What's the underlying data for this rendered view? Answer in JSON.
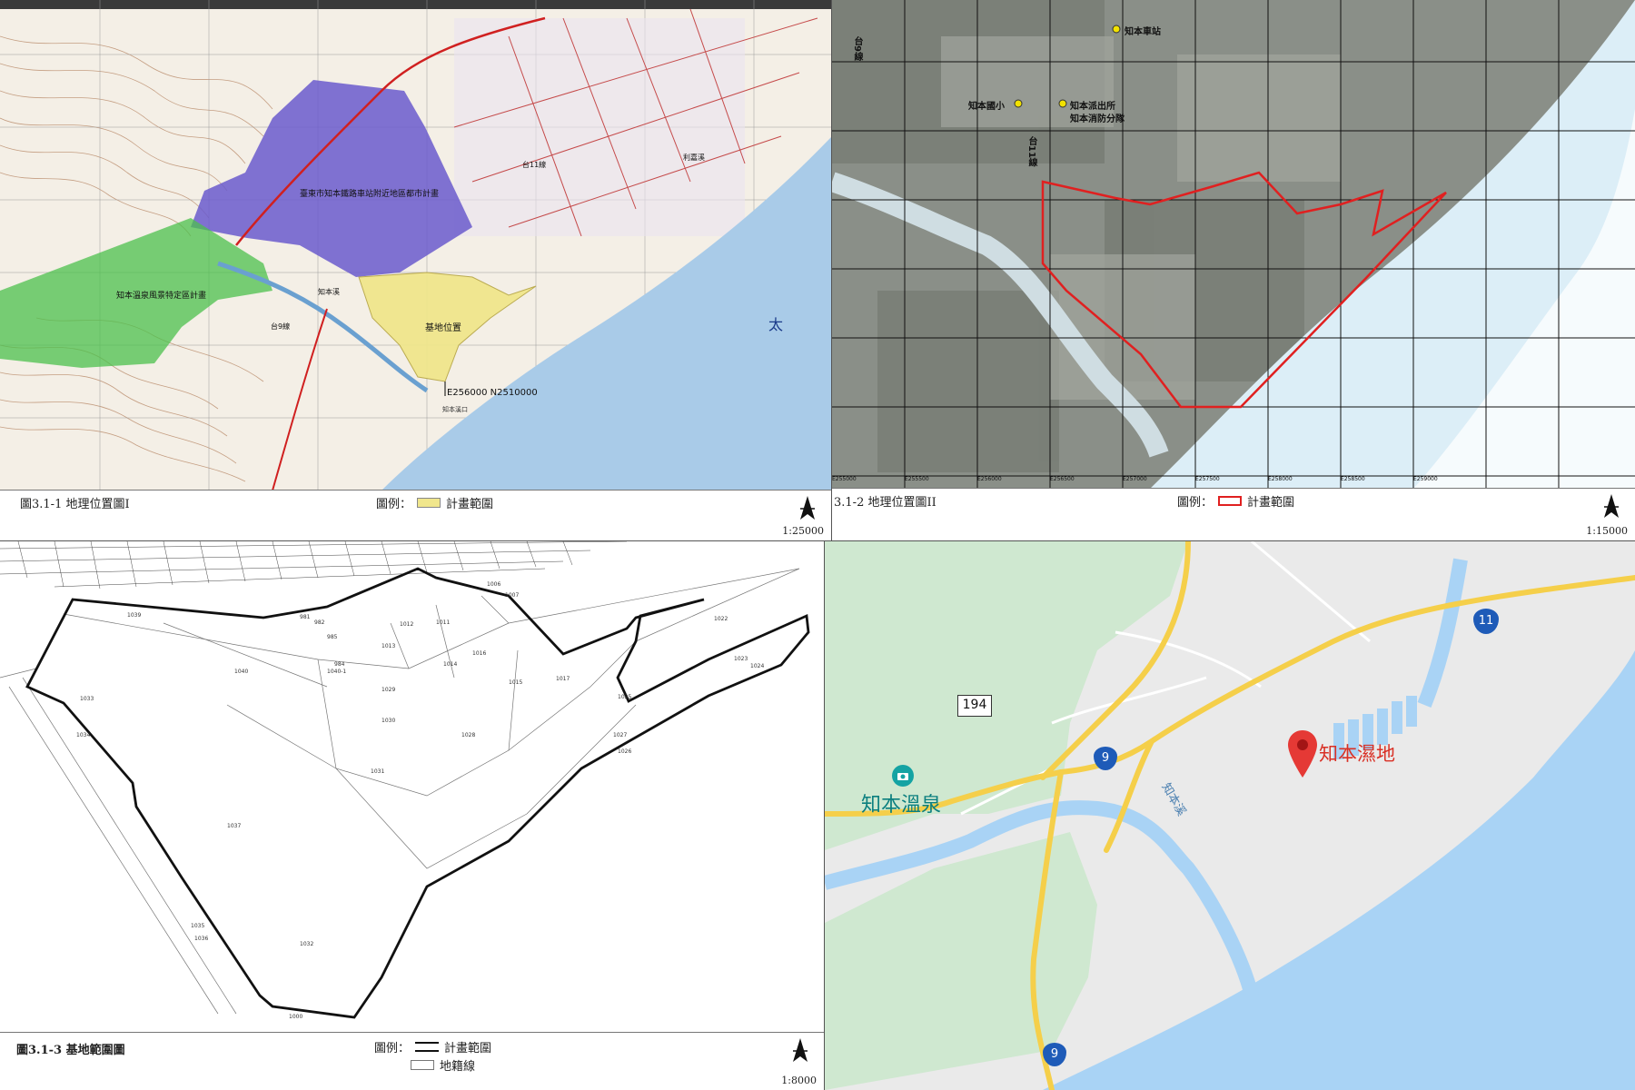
{
  "panel1": {
    "title": "圖3.1-1 地理位置圖I",
    "legend_label": "圖例：",
    "legend_item": "計畫範圍",
    "scale": "1:25000",
    "labels": {
      "urban_plan": "臺東市知本鐵路車站附近地區都市計畫",
      "hotspring_plan": "知本溫泉風景特定區計畫",
      "site": "基地位置",
      "coords": "E256000 N2510000",
      "river1": "知本溪",
      "river2": "利嘉溪",
      "road1": "台11線",
      "road2": "台9線",
      "sea": "太",
      "estuary": "知本溪口"
    },
    "colors": {
      "urban": "#6a5acd",
      "hotspring": "#4cc04c",
      "site": "#f0e68c",
      "sea": "#a9cbe8"
    }
  },
  "panel2": {
    "title": "3.1-2 地理位置圖II",
    "legend_label": "圖例：",
    "legend_item": "計畫範圍",
    "scale": "1:15000",
    "labels": {
      "school": "知本國小",
      "police": "知本派出所",
      "fire": "知本消防分隊",
      "station": "知本車站",
      "road9": "台9線",
      "road11": "台11線"
    },
    "grid_labels": [
      "E255000",
      "E255500",
      "E256000",
      "E256500",
      "E257000",
      "E257500",
      "E258000",
      "E258500",
      "E259000"
    ]
  },
  "panel3": {
    "title": "圖3.1-3 基地範圍圖",
    "legend_label": "圖例：",
    "legend_items": [
      "計畫範圍",
      "地籍線"
    ],
    "scale": "1:8000",
    "parcels": [
      "1040",
      "1037",
      "1031",
      "1032",
      "1033",
      "1034",
      "1035",
      "1036",
      "1029",
      "1030",
      "1028",
      "1017",
      "1014",
      "1013",
      "1012",
      "1011",
      "1007",
      "1006",
      "1015",
      "1016",
      "1022",
      "1023",
      "1024",
      "1025",
      "1026",
      "1027",
      "1039",
      "1000",
      "1040-1",
      "984",
      "985",
      "982",
      "981"
    ]
  },
  "panel4": {
    "labels": {
      "hotspring": "知本溫泉",
      "wetland": "知本濕地",
      "river": "知本溪"
    },
    "shields": {
      "r194": "194",
      "r9a": "9",
      "r9b": "9",
      "r11": "11"
    },
    "colors": {
      "land": "#eaeaea",
      "green": "#cfe8d0",
      "water": "#a9d3f5",
      "road": "#f5cf4a",
      "pin": "#e53935"
    }
  }
}
